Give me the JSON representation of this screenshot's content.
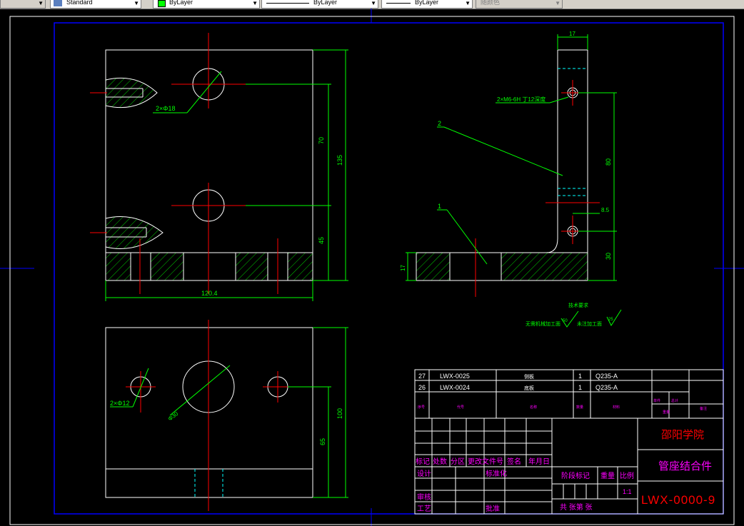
{
  "toolbar": {
    "text_style": "Standard",
    "layer_color": "ByLayer",
    "linetype": "ByLayer",
    "lineweight": "ByLayer",
    "plot_style": "随颜色"
  },
  "colors": {
    "background": "#000000",
    "geometry": "#ffffff",
    "dimension": "#00ff00",
    "centerline": "#ff0000",
    "hidden": "#00ffff",
    "border": "#0000ff",
    "titleblock_text": "#ff00ff",
    "titleblock_red": "#ff0000"
  },
  "dims": {
    "hole_top": "2×Φ18",
    "height_70": "70",
    "height_135": "135",
    "height_45": "45",
    "width_120": "120.4",
    "side_17": "17",
    "side_17b": "17",
    "side_80": "80",
    "side_8": "8.5",
    "side_30": "30",
    "thread": "2×M6-6H 丁12深度",
    "hole_bottom": "2×Φ12",
    "dia_30": "Φ30",
    "height_100": "100",
    "height_65": "65"
  },
  "leaders": {
    "leader_2": "2",
    "leader_1": "1"
  },
  "notes": {
    "title": "技术要求",
    "left": "无需机械加工面",
    "left_val": "50",
    "right": "未注加工面",
    "right_val": "25"
  },
  "bom": [
    {
      "no": "27",
      "code": "LWX-0025",
      "name": "侧板",
      "qty": "1",
      "material": "Q235-A"
    },
    {
      "no": "26",
      "code": "LWX-0024",
      "name": "底板",
      "qty": "1",
      "material": "Q235-A"
    }
  ],
  "bom_header": {
    "no": "序号",
    "code": "代号",
    "name": "名称",
    "qty": "数量",
    "material": "材料",
    "weight": "单件",
    "total": "总计",
    "note": "备注",
    "mass": "重量"
  },
  "title_block": {
    "school": "邵阳学院",
    "drawing_title": "管座结合件",
    "drawing_no": "LWX-0000-9",
    "mark": "标记",
    "count": "处数",
    "zone": "分区",
    "change_doc": "更改文件号",
    "sign": "签名",
    "date": "年月日",
    "design": "设计",
    "standard": "标准化",
    "stage": "阶段标记",
    "weight": "重量",
    "scale": "比例",
    "scale_val": "1:1",
    "check": "审核",
    "process": "工艺",
    "approve": "批准",
    "sheets": "共  张第  张"
  }
}
